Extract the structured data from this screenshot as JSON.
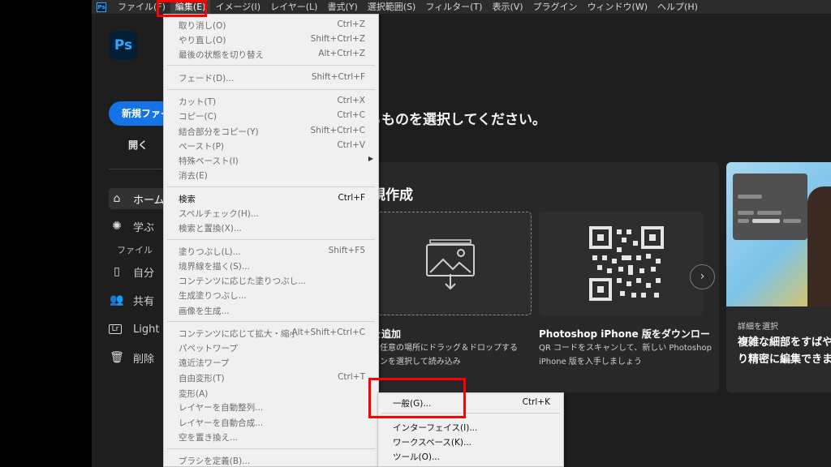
{
  "menubar": {
    "app_icon": "Ps",
    "items": [
      "ファイル(F)",
      "編集(E)",
      "イメージ(I)",
      "レイヤー(L)",
      "書式(Y)",
      "選択範囲(S)",
      "フィルター(T)",
      "表示(V)",
      "プラグイン",
      "ウィンドウ(W)",
      "ヘルプ(H)"
    ],
    "active_index": 1
  },
  "app": {
    "logo": "Ps",
    "new_button": "新規ファイ",
    "open_button": "開く",
    "sidebar": {
      "home": "ホーム",
      "learn": "学ぶ",
      "file_heading": "ファイル",
      "mine": "自分",
      "shared": "共有",
      "lightroom": "Light",
      "deleted": "削除"
    },
    "headline": "るものを選択してください。",
    "panel_title": "規作成",
    "dropzone_icon": "image-import-icon",
    "card1": {
      "title": "を追加",
      "desc1": "の任意の場所にドラッグ＆ドロップする",
      "desc2": "コンを選択して読み込み"
    },
    "card2": {
      "title": "Photoshop iPhone 版をダウンロー",
      "desc1": "QR コードをスキャンして、新しい Photoshop",
      "desc2": "iPhone 版を入手しましょう"
    },
    "promo": {
      "subtitle": "詳細を選択",
      "title1": "複雑な細部をすばや",
      "title2": "り精密に編集できま"
    }
  },
  "edit_menu": {
    "items": [
      {
        "label": "取り消し(O)",
        "shortcut": "Ctrl+Z",
        "enabled": false
      },
      {
        "label": "やり直し(O)",
        "shortcut": "Shift+Ctrl+Z",
        "enabled": false
      },
      {
        "label": "最後の状態を切り替え",
        "shortcut": "Alt+Ctrl+Z",
        "enabled": false
      },
      {
        "label": "フェード(D)...",
        "shortcut": "Shift+Ctrl+F",
        "enabled": false
      },
      {
        "label": "カット(T)",
        "shortcut": "Ctrl+X",
        "enabled": false
      },
      {
        "label": "コピー(C)",
        "shortcut": "Ctrl+C",
        "enabled": false
      },
      {
        "label": "結合部分をコピー(Y)",
        "shortcut": "Shift+Ctrl+C",
        "enabled": false
      },
      {
        "label": "ペースト(P)",
        "shortcut": "Ctrl+V",
        "enabled": false
      },
      {
        "label": "特殊ペースト(I)",
        "shortcut": "",
        "enabled": false,
        "submenu": true
      },
      {
        "label": "消去(E)",
        "shortcut": "",
        "enabled": false
      },
      {
        "label": "検索",
        "shortcut": "Ctrl+F",
        "enabled": true
      },
      {
        "label": "スペルチェック(H)...",
        "shortcut": "",
        "enabled": false
      },
      {
        "label": "検索と置換(X)...",
        "shortcut": "",
        "enabled": false
      },
      {
        "label": "塗りつぶし(L)...",
        "shortcut": "Shift+F5",
        "enabled": false
      },
      {
        "label": "境界線を描く(S)...",
        "shortcut": "",
        "enabled": false
      },
      {
        "label": "コンテンツに応じた塗りつぶし...",
        "shortcut": "",
        "enabled": false
      },
      {
        "label": "生成塗りつぶし...",
        "shortcut": "",
        "enabled": false
      },
      {
        "label": "画像を生成...",
        "shortcut": "",
        "enabled": false
      },
      {
        "label": "コンテンツに応じて拡大・縮小",
        "shortcut": "Alt+Shift+Ctrl+C",
        "enabled": false
      },
      {
        "label": "パペットワープ",
        "shortcut": "",
        "enabled": false
      },
      {
        "label": "遠近法ワープ",
        "shortcut": "",
        "enabled": false
      },
      {
        "label": "自由変形(T)",
        "shortcut": "Ctrl+T",
        "enabled": false
      },
      {
        "label": "変形(A)",
        "shortcut": "",
        "enabled": false
      },
      {
        "label": "レイヤーを自動整列...",
        "shortcut": "",
        "enabled": false
      },
      {
        "label": "レイヤーを自動合成...",
        "shortcut": "",
        "enabled": false
      },
      {
        "label": "空を置き換え...",
        "shortcut": "",
        "enabled": false
      },
      {
        "label": "ブラシを定義(B)...",
        "shortcut": "",
        "enabled": false
      }
    ]
  },
  "preferences_submenu": {
    "items": [
      {
        "label": "一般(G)...",
        "shortcut": "Ctrl+K"
      },
      {
        "label": "インターフェイス(I)...",
        "shortcut": ""
      },
      {
        "label": "ワークスペース(K)...",
        "shortcut": ""
      },
      {
        "label": "ツール(O)...",
        "shortcut": ""
      }
    ]
  }
}
